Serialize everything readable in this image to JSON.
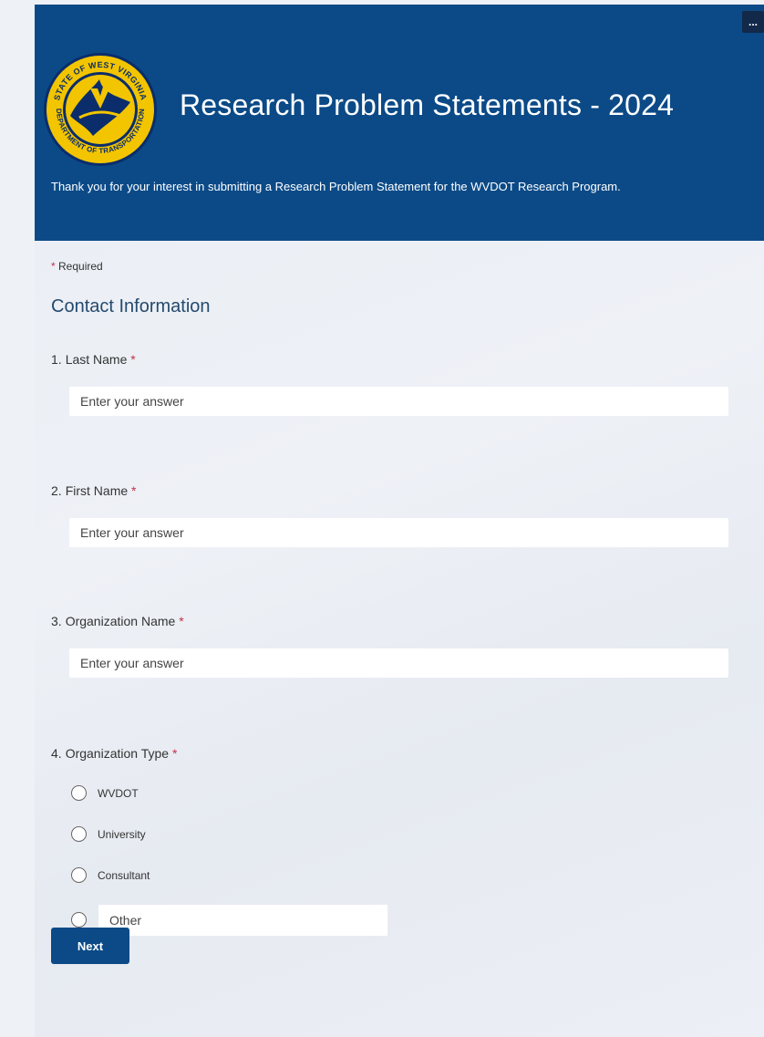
{
  "header": {
    "title": "Research Problem Statements - 2024",
    "intro": "Thank you for your interest in submitting a Research Problem Statement for the WVDOT Research Program.",
    "more_label": "...",
    "logo": {
      "top_text": "STATE OF WEST VIRGINIA",
      "bottom_text": "DEPARTMENT OF TRANSPORTATION",
      "ring_color": "#f2c500"
    }
  },
  "required_note": {
    "star": "*",
    "text": "Required"
  },
  "section_title": "Contact Information",
  "questions": [
    {
      "number": "1.",
      "label": "Last Name",
      "required": "*",
      "placeholder": "Enter your answer"
    },
    {
      "number": "2.",
      "label": "First Name",
      "required": "*",
      "placeholder": "Enter your answer"
    },
    {
      "number": "3.",
      "label": "Organization Name",
      "required": "*",
      "placeholder": "Enter your answer"
    },
    {
      "number": "4.",
      "label": "Organization Type",
      "required": "*",
      "options": [
        "WVDOT",
        "University",
        "Consultant"
      ],
      "other_placeholder": "Other"
    }
  ],
  "next_label": "Next",
  "colors": {
    "header_bg": "#0b4a87",
    "accent": "#0b4a87",
    "required": "#c4314b"
  }
}
